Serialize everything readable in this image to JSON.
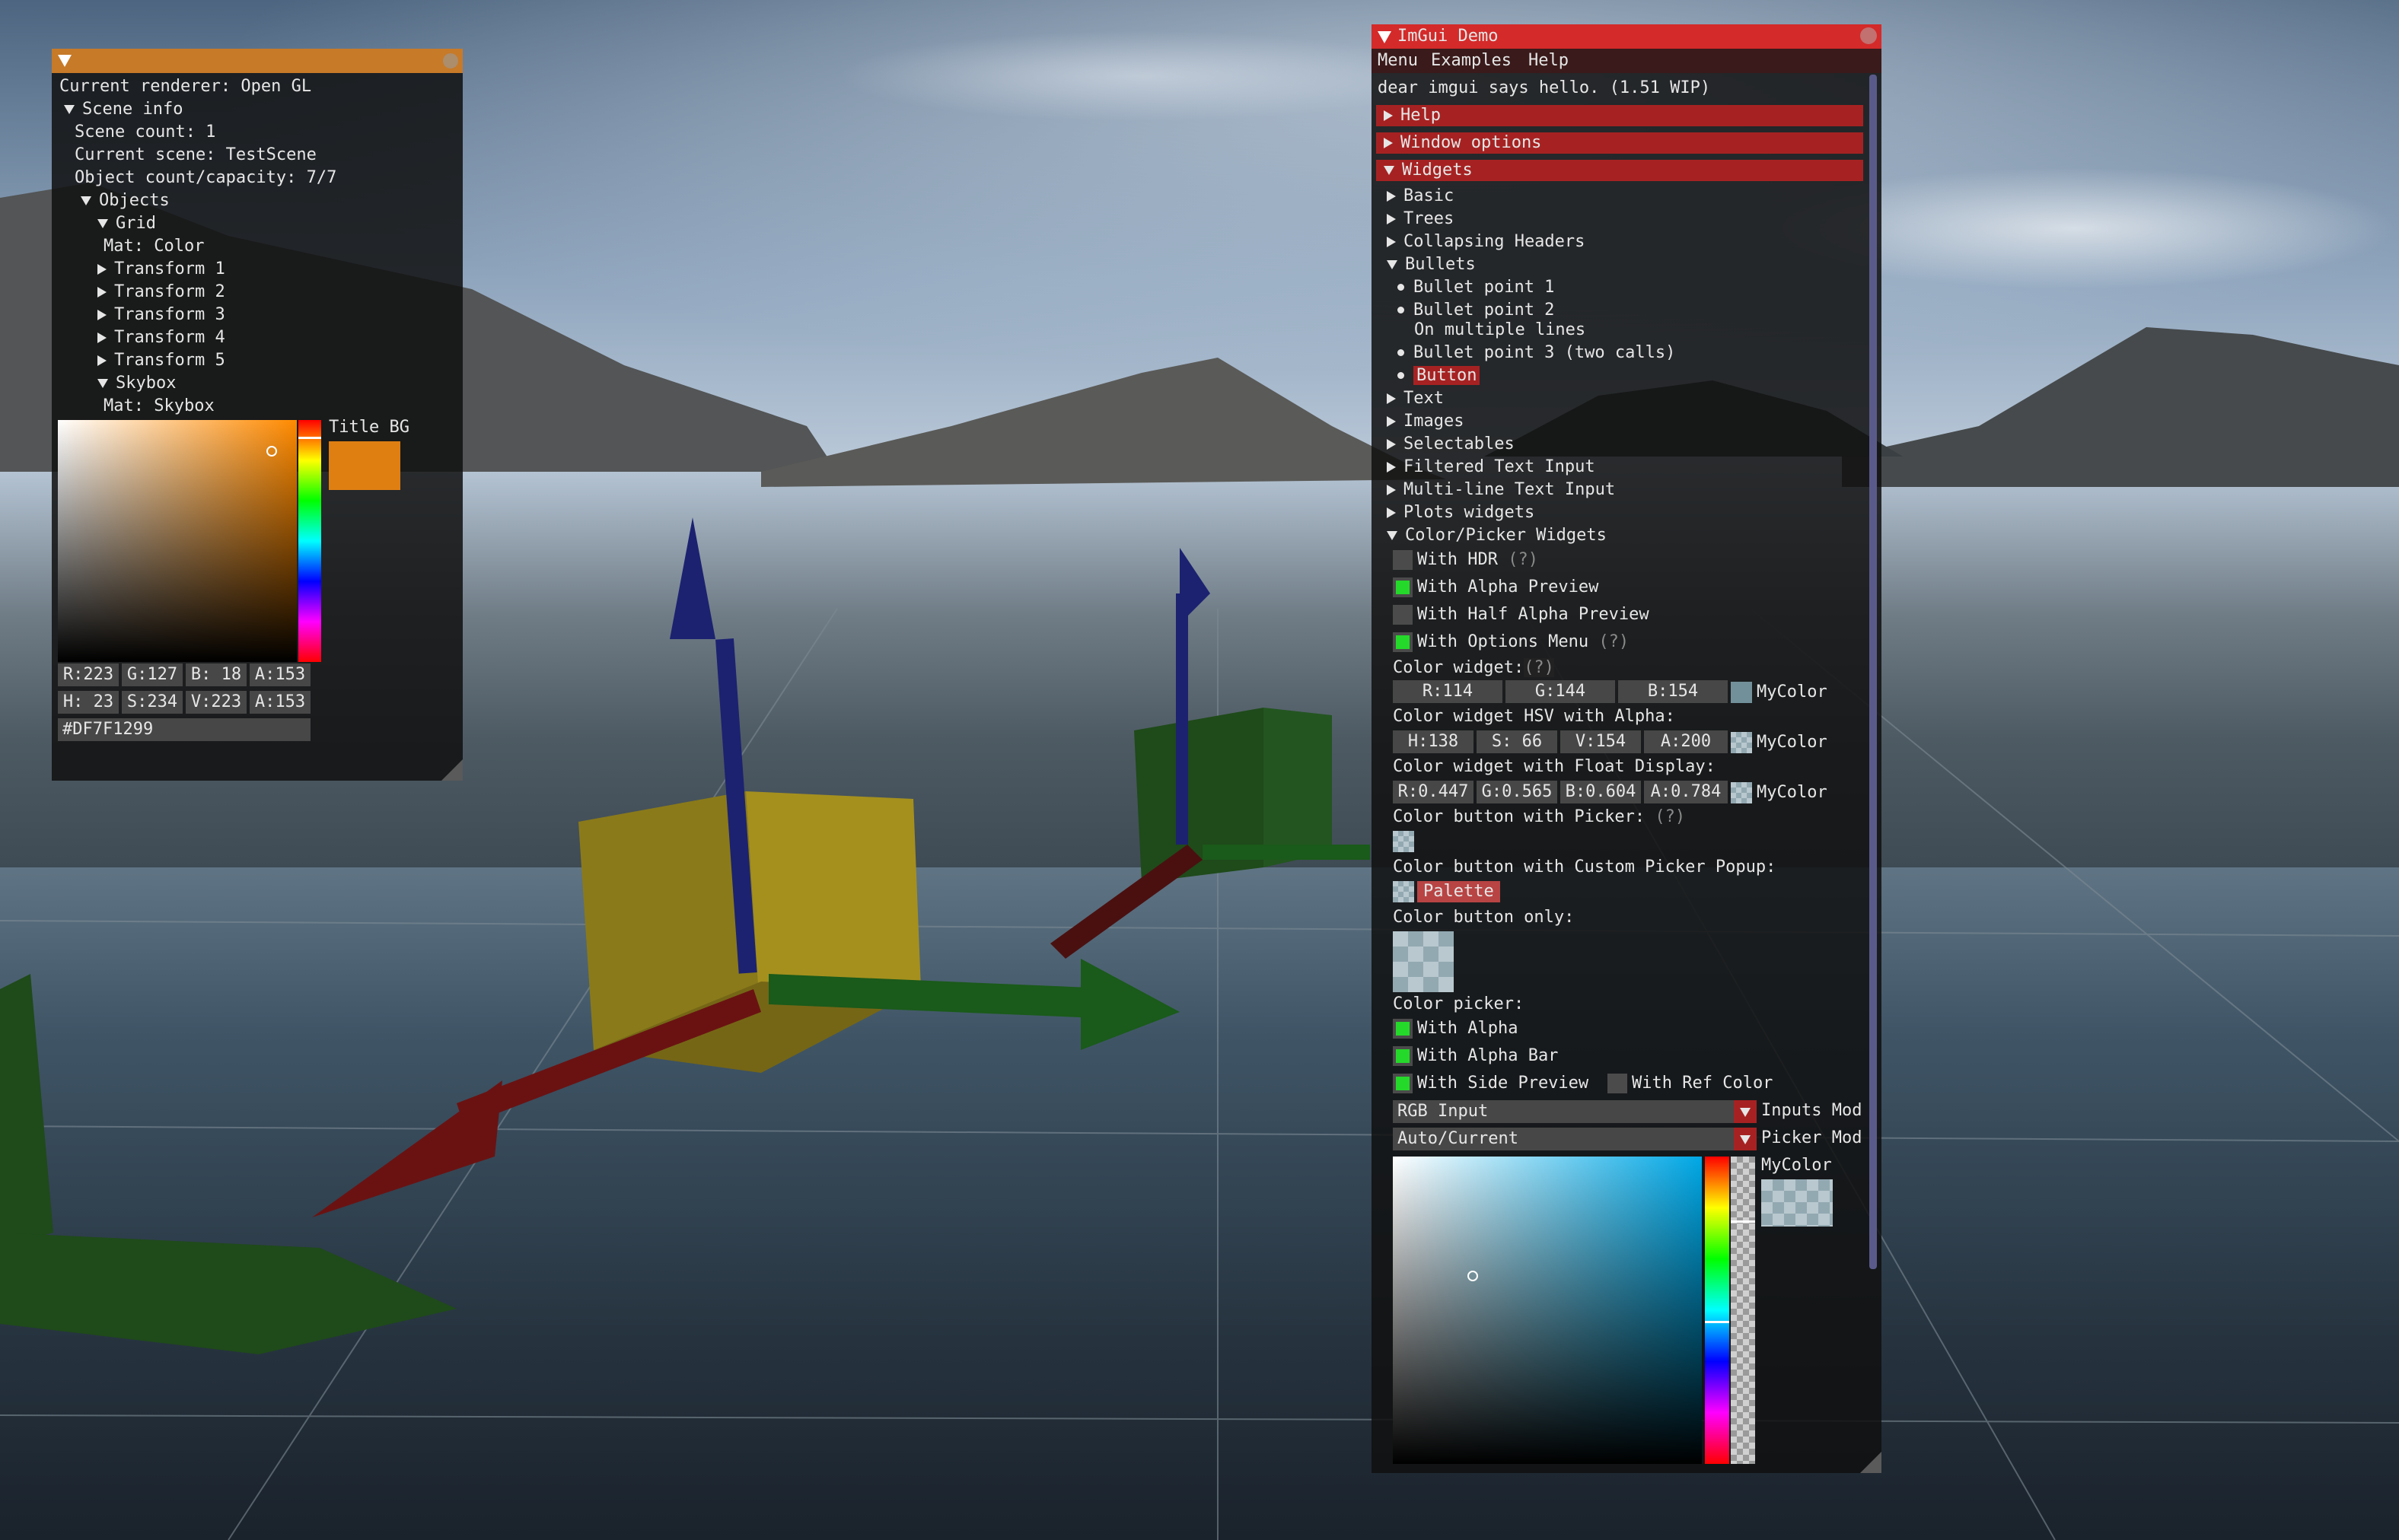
{
  "left_panel": {
    "renderer": "Current renderer: Open GL",
    "scene_info": "Scene info",
    "scene_count": "Scene count: 1",
    "current_scene": "Current scene: TestScene",
    "object_count": "Object count/capacity: 7/7",
    "objects": "Objects",
    "grid": "Grid",
    "mat_color": "Mat: Color",
    "transforms": [
      "Transform 1",
      "Transform 2",
      "Transform 3",
      "Transform 4",
      "Transform 5"
    ],
    "skybox": "Skybox",
    "mat_skybox": "Mat: Skybox",
    "picker_label": "Title BG",
    "picker_color": "#DF7F12",
    "rgba": [
      "R:223",
      "G:127",
      "B: 18",
      "A:153"
    ],
    "hsva": [
      "H: 23",
      "S:234",
      "V:223",
      "A:153"
    ],
    "hex": "#DF7F1299"
  },
  "demo": {
    "title": "ImGui Demo",
    "menu": [
      "Menu",
      "Examples",
      "Help"
    ],
    "hello": "dear imgui says hello. (1.51 WIP)",
    "headers": [
      "Help",
      "Window options",
      "Widgets"
    ],
    "tree_items_top": [
      "Basic",
      "Trees",
      "Collapsing Headers",
      "Bullets"
    ],
    "bullets": [
      "Bullet point 1",
      "Bullet point 2",
      "On multiple lines",
      "Bullet point 3 (two calls)"
    ],
    "bullet_button": "Button",
    "tree_items_mid": [
      "Text",
      "Images",
      "Selectables",
      "Filtered Text Input",
      "Multi-line Text Input",
      "Plots widgets",
      "Color/Picker Widgets"
    ],
    "options": [
      {
        "label": "With HDR",
        "checked": false,
        "hint": "(?)"
      },
      {
        "label": "With Alpha Preview",
        "checked": true,
        "hint": ""
      },
      {
        "label": "With Half Alpha Preview",
        "checked": false,
        "hint": ""
      },
      {
        "label": "With Options Menu",
        "checked": true,
        "hint": "(?)"
      }
    ],
    "color_widget": "Color widget:",
    "q": "(?)",
    "rgb_fields": [
      "R:114",
      "G:144",
      "B:154"
    ],
    "mycolor": "MyColor",
    "hsv_title": "Color widget HSV with Alpha:",
    "hsv_fields": [
      "H:138",
      "S: 66",
      "V:154",
      "A:200"
    ],
    "float_title": "Color widget with Float Display:",
    "float_fields": [
      "R:0.447",
      "G:0.565",
      "B:0.604",
      "A:0.784"
    ],
    "btn_picker": "Color button with Picker:",
    "custom_popup": "Color button with Custom Picker Popup:",
    "palette": "Palette",
    "btn_only": "Color button only:",
    "picker_title": "Color picker:",
    "with_alpha": "With Alpha",
    "with_alpha_bar": "With Alpha Bar",
    "with_side_preview": "With Side Preview",
    "with_ref_color": "With Ref Color",
    "inputs_value": "RGB Input",
    "inputs_label": "Inputs Mod",
    "picker_value": "Auto/Current",
    "picker_label": "Picker Mod",
    "accent": "#a62222",
    "check_green": "#25d92a",
    "mycolor_hex": "#72909A"
  }
}
